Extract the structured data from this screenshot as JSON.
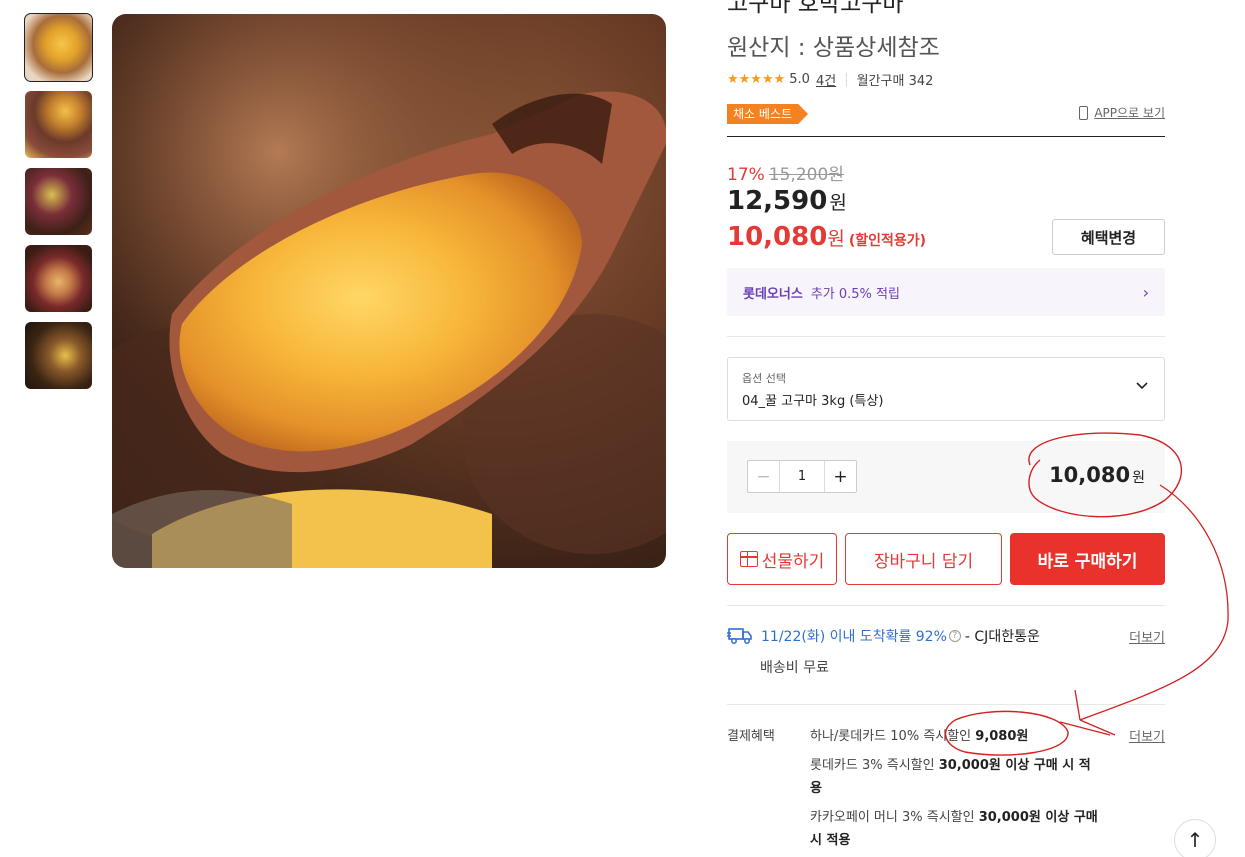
{
  "product": {
    "title": "고구마 호박고구마",
    "origin": "원산지 : 상품상세참조",
    "stars": "★★★★★",
    "rating": "5.0",
    "reviews": "4건",
    "monthly": "월간구매 342",
    "badge": "채소 베스트",
    "app_link": "APP으로 보기"
  },
  "price": {
    "discount_rate": "17%",
    "original": "15,200원",
    "price": "12,590",
    "won": "원",
    "sale_price": "10,080",
    "sale_note": "(할인적용가)",
    "benefit_button": "혜택변경"
  },
  "points": {
    "brand": "롯데오너스",
    "text": "추가 0.5% 적립"
  },
  "option": {
    "label": "옵션 선택",
    "value": "04_꿀 고구마 3kg (특상)"
  },
  "quantity": {
    "minus": "−",
    "value": "1",
    "plus": "+",
    "total": "10,080",
    "won": "원"
  },
  "buttons": {
    "gift": "선물하기",
    "cart": "장바구니 담기",
    "buy": "바로 구매하기"
  },
  "delivery": {
    "eta": "11/22(화) 이내 도착확률 92%",
    "help": "?",
    "carrier": " - CJ대한통운",
    "more": "더보기",
    "shipping": "배송비 무료"
  },
  "payment": {
    "label": "결제혜택",
    "more": "더보기",
    "items": [
      {
        "text": "하나/롯데카드 10% 즉시할인 ",
        "bold": "9,080원"
      },
      {
        "text": "롯데카드 3% 즉시할인 ",
        "bold": "30,000원 이상 구매 시 적용"
      },
      {
        "text": "카카오페이 머니 3% 즉시할인 ",
        "bold": "30,000원 이상 구매 시 적용"
      }
    ]
  },
  "scroll_top": "↑",
  "colors": {
    "accent_red": "#e8322b",
    "badge_orange": "#f58220",
    "points_purple": "#6a3fb5",
    "delivery_blue": "#2f6fd1",
    "star": "#f59a23"
  }
}
